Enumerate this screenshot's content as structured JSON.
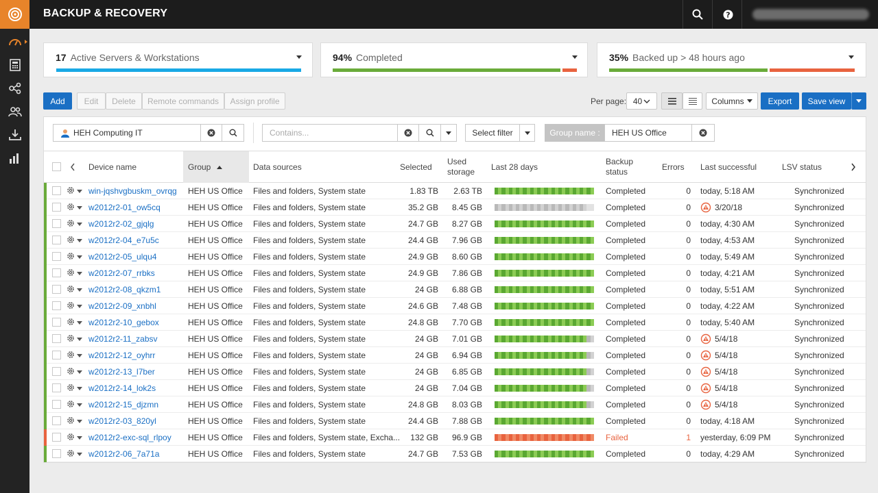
{
  "app": {
    "title": "BACKUP & RECOVERY"
  },
  "colors": {
    "accent": "#e8842a",
    "primary": "#1a6fc4",
    "ok": "#6aab3a",
    "fail": "#e8633f",
    "sky": "#19a9e5"
  },
  "sidebar": {
    "items": [
      {
        "name": "dashboard-icon",
        "active": true
      },
      {
        "name": "calculator-icon",
        "active": false
      },
      {
        "name": "network-icon",
        "active": false
      },
      {
        "name": "users-icon",
        "active": false
      },
      {
        "name": "download-icon",
        "active": false
      },
      {
        "name": "bar-chart-icon",
        "active": false
      }
    ]
  },
  "summary": [
    {
      "value": "17",
      "label": "Active Servers & Workstations"
    },
    {
      "value": "94%",
      "label": "Completed"
    },
    {
      "value": "35%",
      "label": "Backed up > 48 hours ago"
    }
  ],
  "summary_bars": [
    {
      "segments": [
        {
          "fraction": 1.0,
          "color": "#19a9e5"
        }
      ]
    },
    {
      "segments": [
        {
          "fraction": 0.94,
          "color": "#6aab3a"
        },
        {
          "fraction": 0.06,
          "color": "#e8633f"
        }
      ]
    },
    {
      "segments": [
        {
          "fraction": 0.65,
          "color": "#6aab3a"
        },
        {
          "fraction": 0.35,
          "color": "#e8633f"
        }
      ]
    }
  ],
  "toolbar": {
    "add": "Add",
    "edit": "Edit",
    "delete": "Delete",
    "remote": "Remote commands",
    "assign": "Assign profile",
    "per_page_label": "Per page:",
    "per_page": "40",
    "columns": "Columns",
    "export": "Export",
    "save_view": "Save view"
  },
  "filters": {
    "customer": "HEH Computing IT",
    "contains_placeholder": "Contains...",
    "select_filter": "Select filter",
    "group_label": "Group name :",
    "group_value": "HEH US Office"
  },
  "columns": {
    "device": "Device name",
    "group": "Group",
    "sources": "Data sources",
    "selected": "Selected",
    "used1": "Used",
    "used2": "storage",
    "last28": "Last 28 days",
    "bstatus1": "Backup",
    "bstatus2": "status",
    "errors": "Errors",
    "last_success": "Last successful",
    "lsv": "LSV status"
  },
  "rows": [
    {
      "name": "win-jqshvgbuskm_ovrqg",
      "group": "HEH US Office",
      "sources": "Files and folders, System state",
      "selected": "1.83 TB",
      "used": "2.63 TB",
      "status": "Completed",
      "errors": "0",
      "last": "today, 5:18 AM",
      "warn": false,
      "lsv": "Synchronized",
      "spark": "GGGGGGGGGGGGGGGGGGGGGGGGGGGG"
    },
    {
      "name": "w2012r2-01_ow5cq",
      "group": "HEH US Office",
      "sources": "Files and folders, System state",
      "selected": "35.2 GB",
      "used": "8.45 GB",
      "status": "Completed",
      "errors": "0",
      "last": "3/20/18",
      "warn": true,
      "lsv": "Synchronized",
      "spark": "ggggggggggggggggggggggggggee"
    },
    {
      "name": "w2012r2-02_gjqlg",
      "group": "HEH US Office",
      "sources": "Files and folders, System state",
      "selected": "24.7 GB",
      "used": "8.27 GB",
      "status": "Completed",
      "errors": "0",
      "last": "today, 4:30 AM",
      "warn": false,
      "lsv": "Synchronized",
      "spark": "GGGGGGGGGGGGGGGGGGGGGGGGGGGG"
    },
    {
      "name": "w2012r2-04_e7u5c",
      "group": "HEH US Office",
      "sources": "Files and folders, System state",
      "selected": "24.4 GB",
      "used": "7.96 GB",
      "status": "Completed",
      "errors": "0",
      "last": "today, 4:53 AM",
      "warn": false,
      "lsv": "Synchronized",
      "spark": "GGGGGGGGGGGGGGGGGGGGGGGGGGGG"
    },
    {
      "name": "w2012r2-05_ulqu4",
      "group": "HEH US Office",
      "sources": "Files and folders, System state",
      "selected": "24.9 GB",
      "used": "8.60 GB",
      "status": "Completed",
      "errors": "0",
      "last": "today, 5:49 AM",
      "warn": false,
      "lsv": "Synchronized",
      "spark": "GGGGGGGGGGGGGGGGGGGGGGGGGGGG"
    },
    {
      "name": "w2012r2-07_rrbks",
      "group": "HEH US Office",
      "sources": "Files and folders, System state",
      "selected": "24.9 GB",
      "used": "7.86 GB",
      "status": "Completed",
      "errors": "0",
      "last": "today, 4:21 AM",
      "warn": false,
      "lsv": "Synchronized",
      "spark": "GGGGGGGGGGGGGGGGGGGGGGGGGGGG"
    },
    {
      "name": "w2012r2-08_qkzm1",
      "group": "HEH US Office",
      "sources": "Files and folders, System state",
      "selected": "24 GB",
      "used": "6.88 GB",
      "status": "Completed",
      "errors": "0",
      "last": "today, 5:51 AM",
      "warn": false,
      "lsv": "Synchronized",
      "spark": "GGGGGGGGGGGGGGGGGGGGGGGGGGGG"
    },
    {
      "name": "w2012r2-09_xnbhl",
      "group": "HEH US Office",
      "sources": "Files and folders, System state",
      "selected": "24.6 GB",
      "used": "7.48 GB",
      "status": "Completed",
      "errors": "0",
      "last": "today, 4:22 AM",
      "warn": false,
      "lsv": "Synchronized",
      "spark": "GGGGGGGGGGGGGGGGGGGGGGGGGGGG"
    },
    {
      "name": "w2012r2-10_gebox",
      "group": "HEH US Office",
      "sources": "Files and folders, System state",
      "selected": "24.8 GB",
      "used": "7.70 GB",
      "status": "Completed",
      "errors": "0",
      "last": "today, 5:40 AM",
      "warn": false,
      "lsv": "Synchronized",
      "spark": "GGGGGGGGGGGGGGGGGGGGGGGGGGGG"
    },
    {
      "name": "w2012r2-11_zabsv",
      "group": "HEH US Office",
      "sources": "Files and folders, System state",
      "selected": "24 GB",
      "used": "7.01 GB",
      "status": "Completed",
      "errors": "0",
      "last": "5/4/18",
      "warn": true,
      "lsv": "Synchronized",
      "spark": "GGGGGGGGGGGGGGGGGGGGGGGGGGgg"
    },
    {
      "name": "w2012r2-12_oyhrr",
      "group": "HEH US Office",
      "sources": "Files and folders, System state",
      "selected": "24 GB",
      "used": "6.94 GB",
      "status": "Completed",
      "errors": "0",
      "last": "5/4/18",
      "warn": true,
      "lsv": "Synchronized",
      "spark": "GGGGGGGGGGGGGGGGGGGGGGGGGGgg"
    },
    {
      "name": "w2012r2-13_l7ber",
      "group": "HEH US Office",
      "sources": "Files and folders, System state",
      "selected": "24 GB",
      "used": "6.85 GB",
      "status": "Completed",
      "errors": "0",
      "last": "5/4/18",
      "warn": true,
      "lsv": "Synchronized",
      "spark": "GGGGGGGGGGGGGGGGGGGGGGGGGGgg"
    },
    {
      "name": "w2012r2-14_lok2s",
      "group": "HEH US Office",
      "sources": "Files and folders, System state",
      "selected": "24 GB",
      "used": "7.04 GB",
      "status": "Completed",
      "errors": "0",
      "last": "5/4/18",
      "warn": true,
      "lsv": "Synchronized",
      "spark": "GGGGGGGGGGGGGGGGGGGGGGGGGGgg"
    },
    {
      "name": "w2012r2-15_djzmn",
      "group": "HEH US Office",
      "sources": "Files and folders, System state",
      "selected": "24.8 GB",
      "used": "8.03 GB",
      "status": "Completed",
      "errors": "0",
      "last": "5/4/18",
      "warn": true,
      "lsv": "Synchronized",
      "spark": "GGGGGGGGGGGGGGGGGGGGGGGGGGgg"
    },
    {
      "name": "w2012r2-03_820yl",
      "group": "HEH US Office",
      "sources": "Files and folders, System state",
      "selected": "24.4 GB",
      "used": "7.88 GB",
      "status": "Completed",
      "errors": "0",
      "last": "today, 4:18 AM",
      "warn": false,
      "lsv": "Synchronized",
      "spark": "GGGGGGGGGGGGGGGGGGGGGGGGGGGG"
    },
    {
      "name": "w2012r2-exc-sql_rlpoy",
      "group": "HEH US Office",
      "sources": "Files and folders, System state, Excha...",
      "selected": "132 GB",
      "used": "96.9 GB",
      "status": "Failed",
      "errors": "1",
      "last": "yesterday, 6:09 PM",
      "warn": false,
      "lsv": "Synchronized",
      "spark": "RRRRRRRRRRRRRRRRRRRRRRRRRRRR",
      "failed": true
    },
    {
      "name": "w2012r2-06_7a71a",
      "group": "HEH US Office",
      "sources": "Files and folders, System state",
      "selected": "24.7 GB",
      "used": "7.53 GB",
      "status": "Completed",
      "errors": "0",
      "last": "today, 4:29 AM",
      "warn": false,
      "lsv": "Synchronized",
      "spark": "GGGGGGGGGGGGGGGGGGGGGGGGGGGG"
    }
  ]
}
